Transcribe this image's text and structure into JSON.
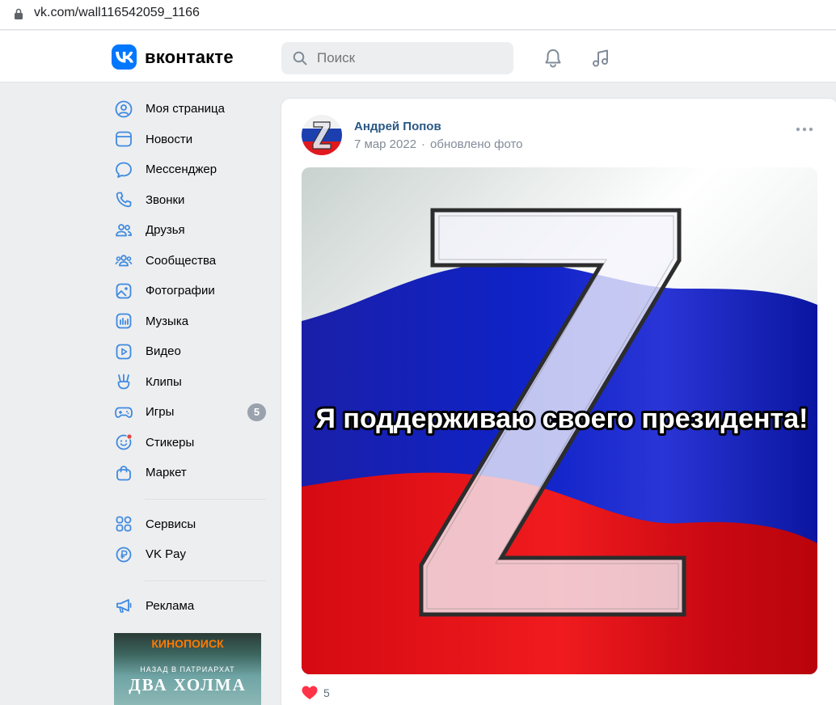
{
  "browser": {
    "url": "vk.com/wall116542059_1166"
  },
  "header": {
    "logo_text": "вконтакте",
    "search_placeholder": "Поиск"
  },
  "sidebar": {
    "items": [
      {
        "label": "Моя страница",
        "icon": "user-circle-icon"
      },
      {
        "label": "Новости",
        "icon": "news-icon"
      },
      {
        "label": "Мессенджер",
        "icon": "message-icon"
      },
      {
        "label": "Звонки",
        "icon": "phone-icon"
      },
      {
        "label": "Друзья",
        "icon": "friends-icon"
      },
      {
        "label": "Сообщества",
        "icon": "communities-icon"
      },
      {
        "label": "Фотографии",
        "icon": "photo-icon"
      },
      {
        "label": "Музыка",
        "icon": "music-icon"
      },
      {
        "label": "Видео",
        "icon": "video-icon"
      },
      {
        "label": "Клипы",
        "icon": "clips-icon"
      },
      {
        "label": "Игры",
        "icon": "games-icon",
        "badge": "5"
      },
      {
        "label": "Стикеры",
        "icon": "stickers-icon"
      },
      {
        "label": "Маркет",
        "icon": "market-icon"
      }
    ],
    "secondary": [
      {
        "label": "Сервисы",
        "icon": "services-icon"
      },
      {
        "label": "VK Pay",
        "icon": "vkpay-icon"
      }
    ],
    "tertiary": [
      {
        "label": "Реклама",
        "icon": "megaphone-icon"
      }
    ],
    "ad": {
      "brand": "КИНОПОИСК",
      "subtitle": "НАЗАД В ПАТРИАРХАТ",
      "title": "ДВА ХОЛМА"
    }
  },
  "post": {
    "author": "Андрей Попов",
    "date": "7 мар 2022",
    "separator": "·",
    "action": "обновлено фото",
    "image_caption": "Я поддерживаю своего президента!",
    "likes": "5"
  },
  "colors": {
    "accent": "#0077ff",
    "link": "#2a5885",
    "icon": "#3f8ae0",
    "muted": "#818c99"
  }
}
